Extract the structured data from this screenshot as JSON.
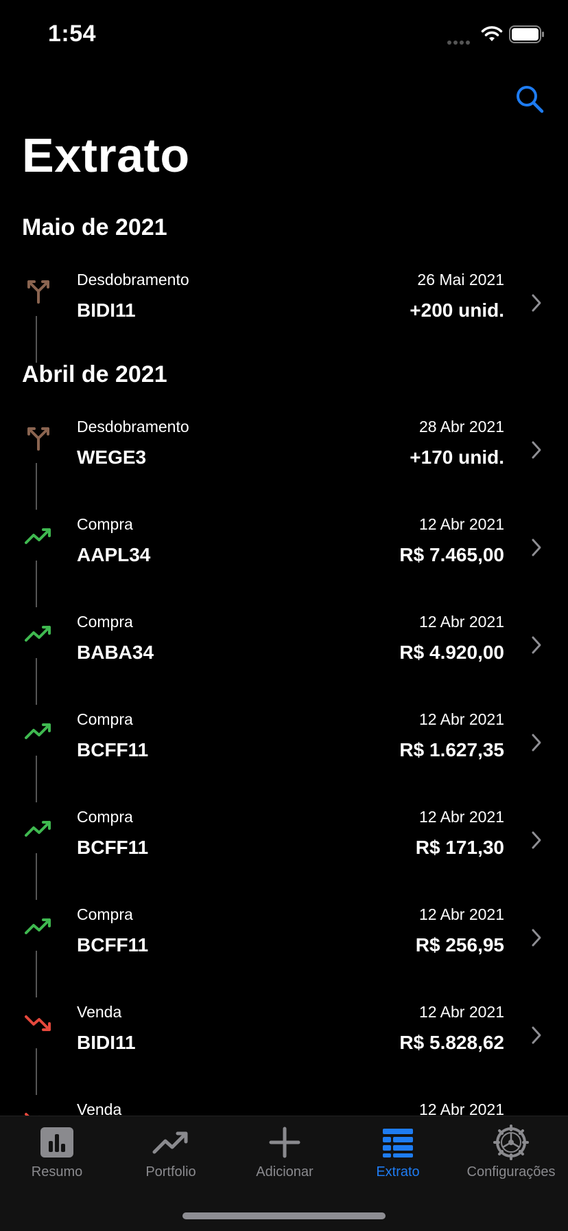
{
  "status_bar": {
    "time": "1:54"
  },
  "header": {
    "title": "Extrato"
  },
  "colors": {
    "accent": "#1e7cf2",
    "buy": "#3fb950",
    "sell": "#e5483c",
    "split": "#8a6450"
  },
  "sections": [
    {
      "title": "Maio de 2021",
      "items": [
        {
          "type": "split",
          "kind": "Desdobramento",
          "ticker": "BIDI11",
          "date": "26 Mai 2021",
          "amount": "+200 unid."
        }
      ]
    },
    {
      "title": "Abril de 2021",
      "items": [
        {
          "type": "split",
          "kind": "Desdobramento",
          "ticker": "WEGE3",
          "date": "28 Abr 2021",
          "amount": "+170 unid."
        },
        {
          "type": "buy",
          "kind": "Compra",
          "ticker": "AAPL34",
          "date": "12 Abr 2021",
          "amount": "R$ 7.465,00"
        },
        {
          "type": "buy",
          "kind": "Compra",
          "ticker": "BABA34",
          "date": "12 Abr 2021",
          "amount": "R$ 4.920,00"
        },
        {
          "type": "buy",
          "kind": "Compra",
          "ticker": "BCFF11",
          "date": "12 Abr 2021",
          "amount": "R$ 1.627,35"
        },
        {
          "type": "buy",
          "kind": "Compra",
          "ticker": "BCFF11",
          "date": "12 Abr 2021",
          "amount": "R$ 171,30"
        },
        {
          "type": "buy",
          "kind": "Compra",
          "ticker": "BCFF11",
          "date": "12 Abr 2021",
          "amount": "R$ 256,95"
        },
        {
          "type": "sell",
          "kind": "Venda",
          "ticker": "BIDI11",
          "date": "12 Abr 2021",
          "amount": "R$ 5.828,62"
        },
        {
          "type": "sell",
          "kind": "Venda",
          "ticker": "",
          "date": "12 Abr 2021",
          "amount": ""
        }
      ]
    }
  ],
  "tabs": [
    {
      "label": "Resumo",
      "icon": "bar-chart-icon",
      "active": false
    },
    {
      "label": "Portfolio",
      "icon": "trend-icon",
      "active": false
    },
    {
      "label": "Adicionar",
      "icon": "plus-icon",
      "active": false
    },
    {
      "label": "Extrato",
      "icon": "list-icon",
      "active": true
    },
    {
      "label": "Configurações",
      "icon": "gear-icon",
      "active": false
    }
  ]
}
